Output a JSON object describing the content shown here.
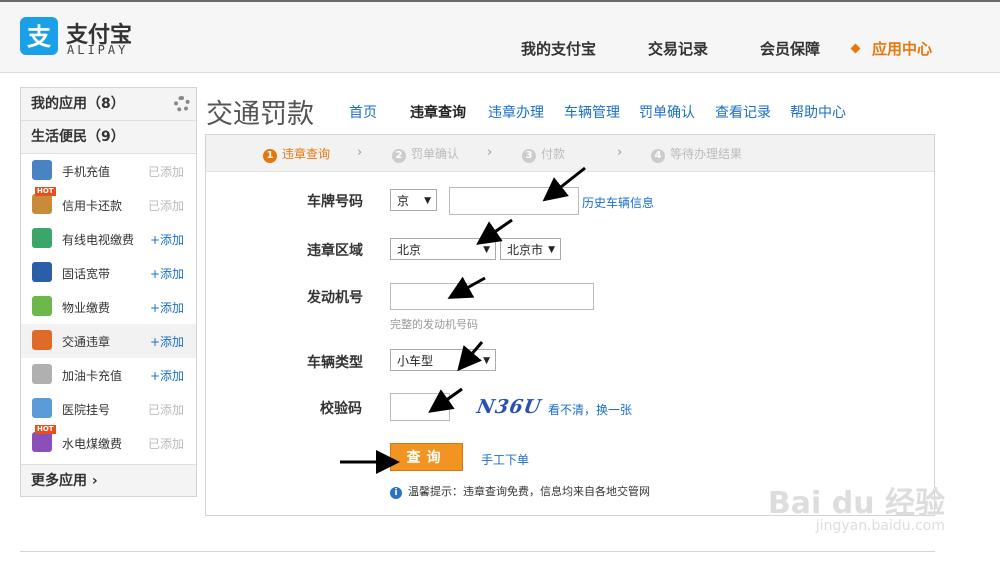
{
  "logo": {
    "cn": "支付宝",
    "en": "ALIPAY",
    "color": "#1aa0e6"
  },
  "nav": [
    {
      "label": "我的支付宝",
      "active": false
    },
    {
      "label": "交易记录",
      "active": false
    },
    {
      "label": "会员保障",
      "active": false
    },
    {
      "label": "应用中心",
      "active": true
    }
  ],
  "sidebar": {
    "my_apps": "我的应用（8）",
    "category": "生活便民（9）",
    "items": [
      {
        "label": "手机充值",
        "action": "已添加",
        "icon": "phone-icon",
        "color": "#4a83c4"
      },
      {
        "label": "信用卡还款",
        "action": "已添加",
        "icon": "credit-card-icon",
        "color": "#c98a3a",
        "hot": "HOT"
      },
      {
        "label": "有线电视缴费",
        "action": "+添加",
        "icon": "tv-icon",
        "color": "#3aa66a"
      },
      {
        "label": "固话宽带",
        "action": "+添加",
        "icon": "landline-icon",
        "color": "#2a5fa8"
      },
      {
        "label": "物业缴费",
        "action": "+添加",
        "icon": "house-icon",
        "color": "#6cb84a"
      },
      {
        "label": "交通违章",
        "action": "+添加",
        "icon": "car-icon",
        "color": "#e06a2a"
      },
      {
        "label": "加油卡充值",
        "action": "+添加",
        "icon": "fuel-icon",
        "color": "#b0b0b0"
      },
      {
        "label": "医院挂号",
        "action": "已添加",
        "icon": "hospital-icon",
        "color": "#5a9bd8"
      },
      {
        "label": "水电煤缴费",
        "action": "已添加",
        "icon": "utility-icon",
        "color": "#8a4fb8",
        "hot": "HOT"
      }
    ],
    "more": "更多应用"
  },
  "page_title": "交通罚款",
  "tabs": [
    {
      "label": "首页"
    },
    {
      "label": "违章查询",
      "current": true
    },
    {
      "label": "违章办理"
    },
    {
      "label": "车辆管理"
    },
    {
      "label": "罚单确认"
    },
    {
      "label": "查看记录"
    },
    {
      "label": "帮助中心"
    }
  ],
  "steps": [
    {
      "num": "1",
      "label": "违章查询"
    },
    {
      "num": "2",
      "label": "罚单确认"
    },
    {
      "num": "3",
      "label": "付款"
    },
    {
      "num": "4",
      "label": "等待办理结果"
    }
  ],
  "form": {
    "plate_label": "车牌号码",
    "plate_province": "京",
    "plate_value": "",
    "plate_history_link": "历史车辆信息",
    "area_label": "违章区域",
    "area_province": "北京",
    "area_city": "北京市",
    "engine_label": "发动机号",
    "engine_value": "",
    "engine_hint": "完整的发动机号码",
    "type_label": "车辆类型",
    "type_value": "小车型",
    "captcha_label": "校验码",
    "captcha_value": "",
    "captcha_text": "N36U",
    "captcha_refresh": "看不清，换一张",
    "submit": "查询",
    "manual_link": "手工下单",
    "tip": "温馨提示：违章查询免费，信息均来自各地交管网"
  },
  "watermark": {
    "main": "Bai du 经验",
    "sub": "jingyan.baidu.com"
  }
}
